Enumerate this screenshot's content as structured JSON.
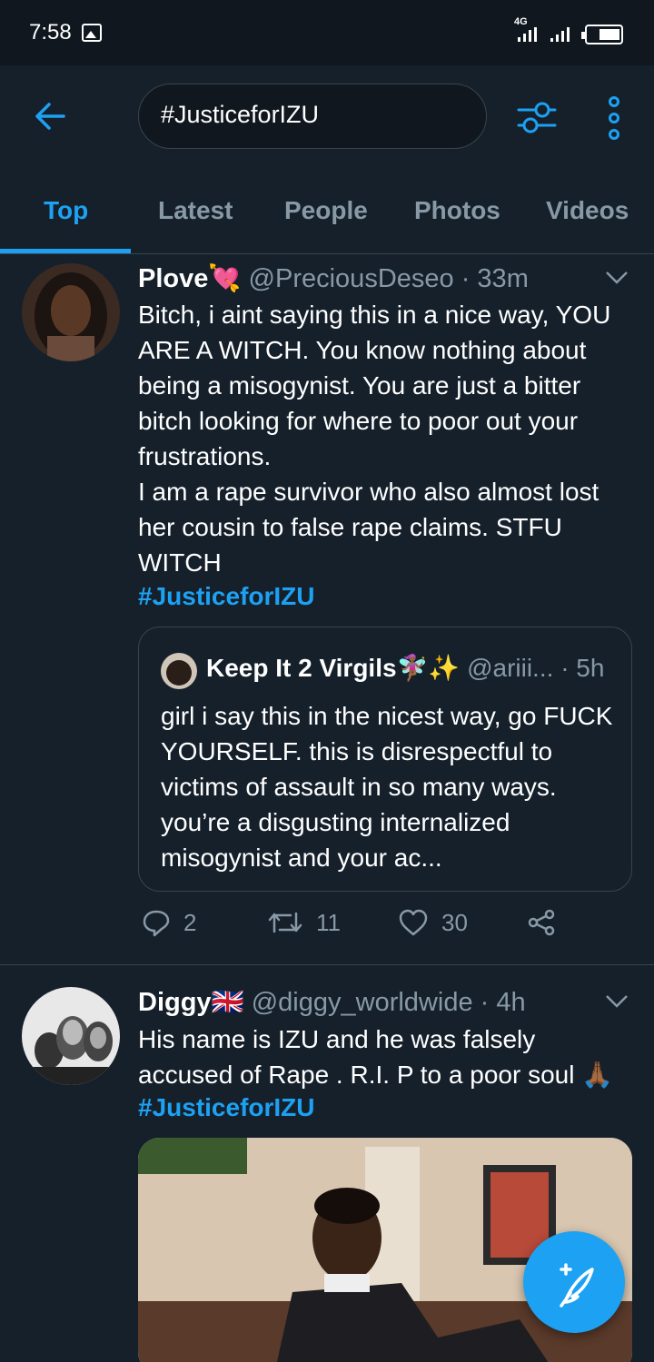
{
  "status_bar": {
    "time": "7:58",
    "network": "4G"
  },
  "search": {
    "query": "#JusticeforIZU"
  },
  "tabs": [
    "Top",
    "Latest",
    "People",
    "Photos",
    "Videos"
  ],
  "tweets": [
    {
      "name": "Plove💘",
      "handle": "@PreciousDeseo",
      "time": "· 33m",
      "text": "Bitch, i aint saying this in a nice way, YOU ARE A WITCH. You know nothing about being a misogynist. You are just a bitter bitch looking for where to poor out your frustrations.\nI am a rape survivor who also almost lost her cousin to false rape claims. STFU WITCH",
      "hashtag": "#JusticeforIZU",
      "quote": {
        "name": "Keep It 2 Virgils🧚🏾‍♀️✨",
        "handle": "@ariii...",
        "time": "· 5h",
        "text": "girl i say this in the nicest way, go FUCK YOURSELF. this is disrespectful to victims of assault in so many ways. you’re a disgusting internalized misogynist and your ac..."
      },
      "replies": "2",
      "retweets": "11",
      "likes": "30"
    },
    {
      "name": "Diggy🇬🇧",
      "handle": "@diggy_worldwide",
      "time": "· 4h",
      "text": "His name is IZU and he was falsely accused of Rape . R.I. P to a poor soul 🙏🏾",
      "hashtag": "#JusticeforIZU"
    }
  ],
  "colors": {
    "accent": "#1da1f2",
    "background": "#15202b",
    "muted": "#8899a6",
    "border": "#38444d"
  }
}
